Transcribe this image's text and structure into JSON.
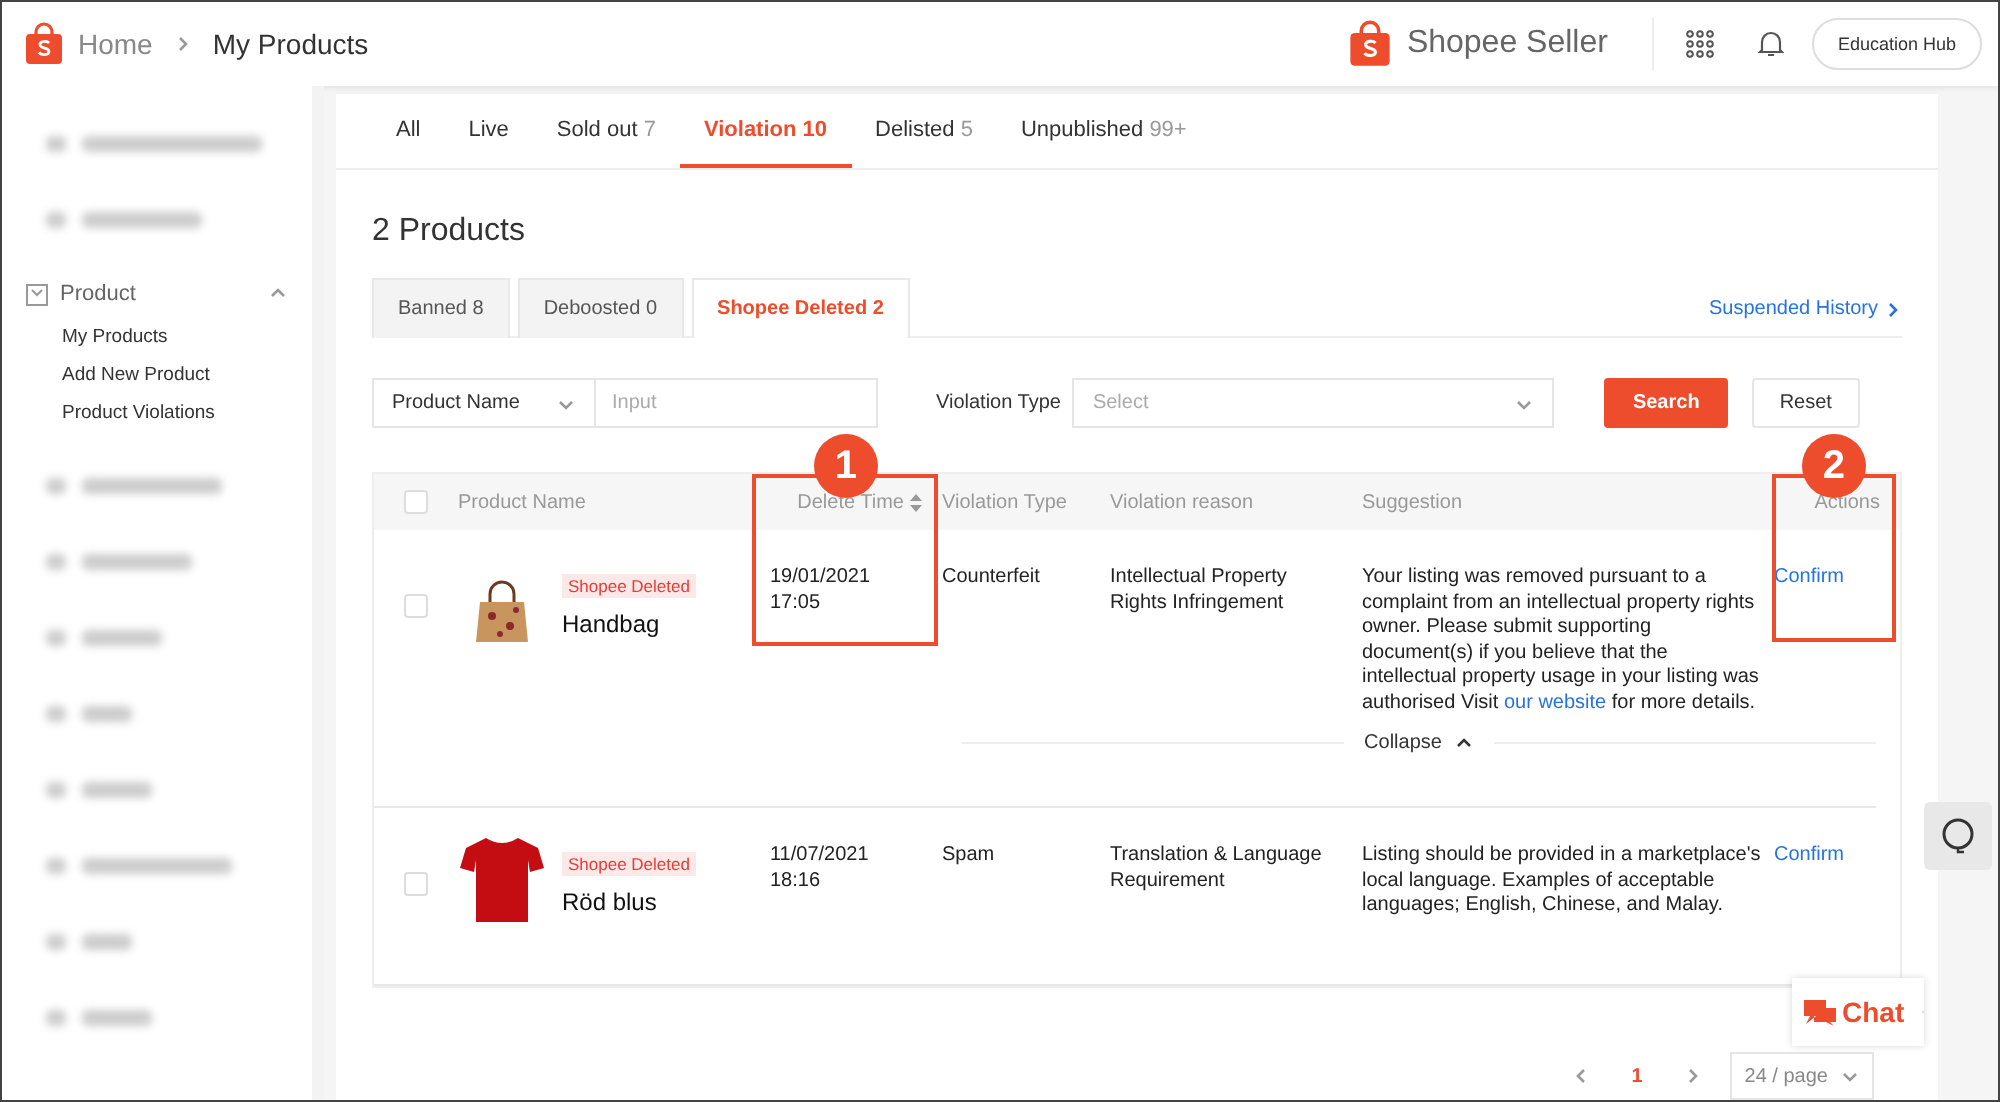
{
  "header": {
    "home": "Home",
    "current": "My Products",
    "brand": "Shopee Seller",
    "button": "Education Hub"
  },
  "sidebar": {
    "section": {
      "label": "Product",
      "expanded": true,
      "children": [
        {
          "label": "My Products"
        },
        {
          "label": "Add New Product"
        },
        {
          "label": "Product Violations"
        }
      ]
    }
  },
  "status_tabs": [
    {
      "label": "All",
      "selected": false
    },
    {
      "label": "Live",
      "selected": false
    },
    {
      "label": "Sold out",
      "count": "7",
      "selected": false
    },
    {
      "label": "Violation",
      "count": "10",
      "selected": true
    },
    {
      "label": "Delisted",
      "count": "5",
      "selected": false
    },
    {
      "label": "Unpublished",
      "count": "99+",
      "selected": false
    }
  ],
  "heading": "2 Products",
  "sub_tabs": [
    {
      "label": "Banned 8",
      "selected": false
    },
    {
      "label": "Deboosted 0",
      "selected": false
    },
    {
      "label": "Shopee Deleted 2",
      "selected": true
    }
  ],
  "history_link": "Suspended History",
  "filters": {
    "name_select": "Product Name",
    "name_placeholder": "Input",
    "type_label": "Violation Type",
    "type_placeholder": "Select",
    "search": "Search",
    "reset": "Reset"
  },
  "table": {
    "select_all_checked": false,
    "columns": [
      {
        "label": "Product Name",
        "sortable": false
      },
      {
        "label": "Delete Time",
        "sortable": true
      },
      {
        "label": "Violation Type",
        "sortable": false
      },
      {
        "label": "Violation reason",
        "sortable": false
      },
      {
        "label": "Suggestion",
        "sortable": false
      },
      {
        "label": "Actions",
        "sortable": false
      }
    ],
    "rows": [
      {
        "checked": false,
        "kind": "handbag",
        "badge": "Shopee Deleted",
        "name": "Handbag",
        "date": "19/01/2021",
        "time": "17:05",
        "violation_type": "Counterfeit",
        "reason": "Intellectual Property Rights Infringement",
        "suggestion": {
          "before": "Your listing was removed pursuant to a complaint from an intellectual property rights owner. Please submit supporting document(s) if you believe that the intellectual property usage in your listing was authorised Visit",
          "link": "our website",
          "after": "for more details."
        },
        "action": "Confirm",
        "toggle": "Collapse"
      },
      {
        "checked": false,
        "kind": "tshirt",
        "badge": "Shopee Deleted",
        "name": "Röd blus",
        "date": "11/07/2021",
        "time": "18:16",
        "violation_type": "Spam",
        "reason": "Translation & Language Requirement",
        "suggestion": {
          "before": "Listing should be provided in a marketplace's local language. Examples of acceptable languages; English, Chinese, and Malay."
        },
        "action": "Confirm"
      }
    ]
  },
  "pagination": {
    "pages": [
      {
        "label": "1",
        "selected": true
      }
    ],
    "page_size": "24 / page"
  },
  "chat": "Chat",
  "annotations": [
    {
      "label": "1"
    },
    {
      "label": "2"
    }
  ]
}
